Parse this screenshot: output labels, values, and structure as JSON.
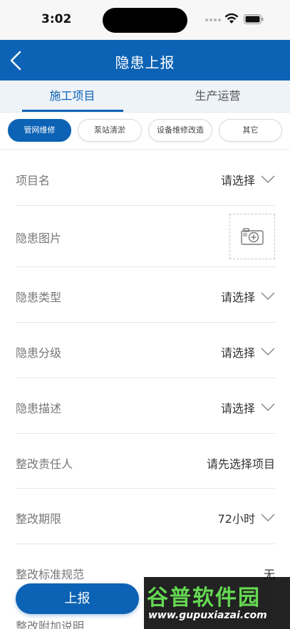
{
  "status_bar": {
    "time": "3:02"
  },
  "navbar": {
    "title": "隐患上报",
    "back_icon": "chevron-left-icon"
  },
  "tabs": [
    {
      "label": "施工项目",
      "active": true
    },
    {
      "label": "生产运营",
      "active": false
    }
  ],
  "categories": [
    {
      "label": "管网维修",
      "active": true
    },
    {
      "label": "泵站清淤",
      "active": false
    },
    {
      "label": "设备维修改造",
      "active": false
    },
    {
      "label": "其它",
      "active": false
    }
  ],
  "form": {
    "project_name": {
      "label": "项目名",
      "value": "请选择"
    },
    "hazard_image": {
      "label": "隐患图片",
      "icon": "camera-add-icon"
    },
    "hazard_type": {
      "label": "隐患类型",
      "value": "请选择"
    },
    "hazard_level": {
      "label": "隐患分级",
      "value": "请选择"
    },
    "hazard_desc": {
      "label": "隐患描述",
      "value": "请选择"
    },
    "rectify_owner": {
      "label": "整改责任人",
      "value": "请先选择项目"
    },
    "rectify_deadline": {
      "label": "整改期限",
      "value": "72小时"
    },
    "rectify_standard": {
      "label": "整改标准规范",
      "value": "无"
    },
    "extra_note": {
      "label": "整改附加说明"
    }
  },
  "submit_label": "上报",
  "watermark": {
    "title": "谷普软件园",
    "url": "www.gupuxiazai.com"
  },
  "colors": {
    "brand": "#0c62b4",
    "tab_bg": "#eef3f8",
    "divider": "#e6e6e6"
  }
}
